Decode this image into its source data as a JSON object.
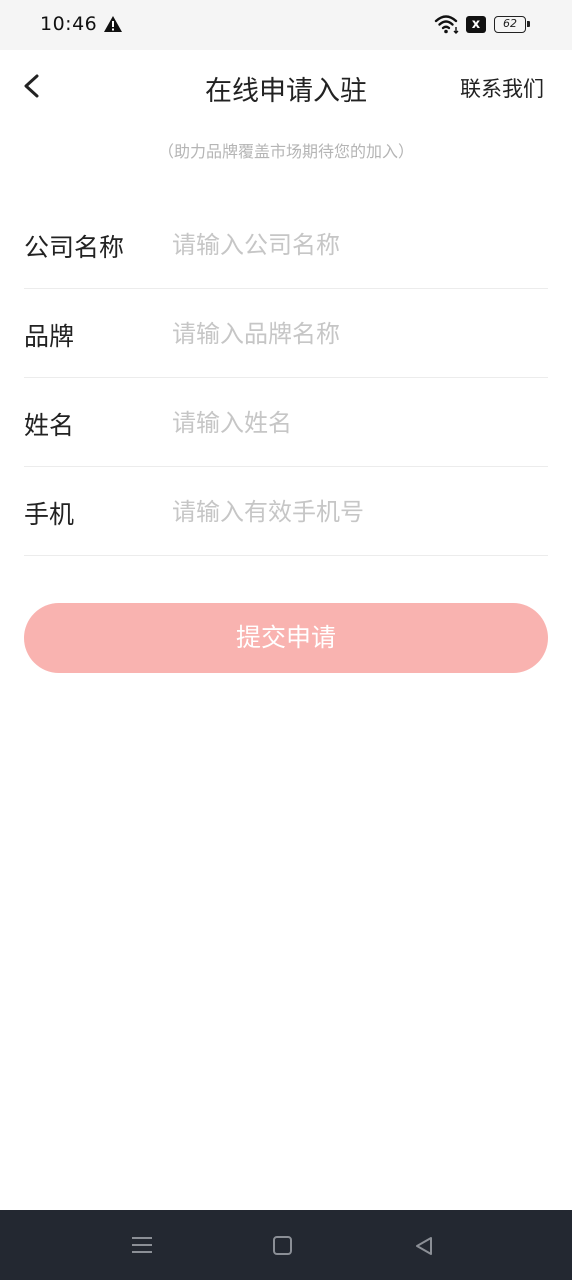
{
  "status_bar": {
    "time": "10:46",
    "battery": "62",
    "sim_icon": "x",
    "icons": [
      "warning-icon",
      "wifi-icon",
      "sim-icon",
      "battery-icon"
    ]
  },
  "header": {
    "back_icon": "chevron-left-icon",
    "title": "在线申请入驻",
    "contact_label": "联系我们"
  },
  "subtitle": "（助力品牌覆盖市场期待您的加入）",
  "form": {
    "fields": [
      {
        "label": "公司名称",
        "value": "",
        "placeholder": "请输入公司名称"
      },
      {
        "label": "品牌",
        "value": "",
        "placeholder": "请输入品牌名称"
      },
      {
        "label": "姓名",
        "value": "",
        "placeholder": "请输入姓名"
      },
      {
        "label": "手机",
        "value": "",
        "placeholder": "请输入有效手机号"
      }
    ]
  },
  "submit": {
    "label": "提交申请",
    "color": "#f9b3b0"
  },
  "system_nav": {
    "icons": [
      "menu-icon",
      "home-icon",
      "back-triangle-icon"
    ],
    "background": "#232831"
  }
}
